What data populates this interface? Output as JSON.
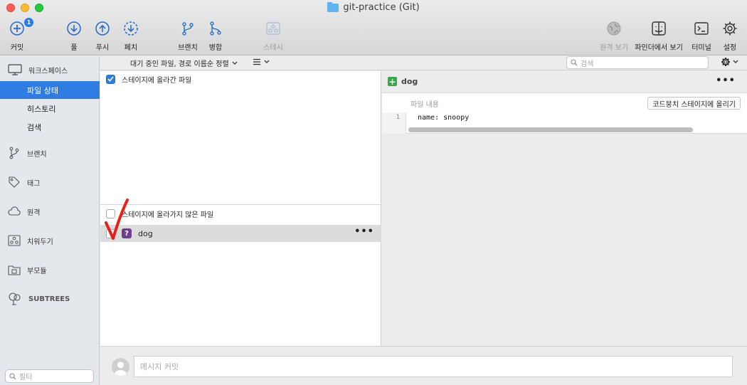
{
  "window": {
    "title": "git-practice (Git)"
  },
  "toolbar": {
    "commit": {
      "label": "커밋",
      "badge": "1"
    },
    "pull": "풀",
    "push": "푸시",
    "fetch": "페치",
    "branch": "브랜치",
    "merge": "병합",
    "stash": "스테시",
    "remote_view": "원격 보기",
    "finder": "파인더에서 보기",
    "terminal": "터미널",
    "settings": "설정"
  },
  "sidebar": {
    "workspace": "워크스페이스",
    "file_status": "파일 상태",
    "history": "히스토리",
    "search": "검색",
    "branches": "브랜치",
    "tags": "태그",
    "remotes": "원격",
    "stashes": "치워두기",
    "submodules": "부모듈",
    "subtrees": "SUBTREES",
    "filter_placeholder": "필터"
  },
  "filebar": {
    "sort_label": "대기 중인 파일, 경로 이름순 정렬",
    "search_placeholder": "검색"
  },
  "staged": {
    "label": "스테이지에 올라간 파일",
    "checked": true
  },
  "unstaged": {
    "label": "스테이지에 올라가지 않은 파일",
    "checked": false,
    "files": [
      {
        "name": "dog",
        "status": "untracked"
      }
    ]
  },
  "diff": {
    "file": "dog",
    "hunk_title": "파일 내용",
    "stage_hunk": "코드뭉치 스테이지에 올리기",
    "lines": [
      {
        "no": "1",
        "text": "name: snoopy"
      }
    ]
  },
  "commit": {
    "placeholder": "메시지 커밋"
  },
  "colors": {
    "accent": "#2f7ce2",
    "added": "#3aa64a",
    "untracked": "#6c3e8c",
    "annotation": "#e8201a"
  }
}
